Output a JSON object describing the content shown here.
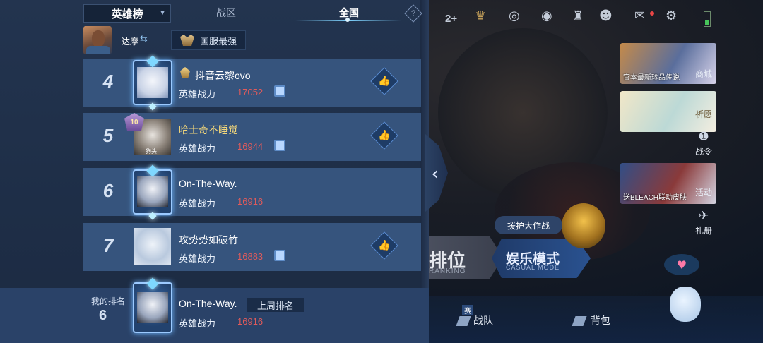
{
  "tabs": {
    "scope_selector": "英雄榜",
    "zone": "战区",
    "all": "全国"
  },
  "hero": {
    "name": "达摩",
    "server_rank": "国服最强"
  },
  "rows": [
    {
      "rank": "4",
      "name": "抖音云黎ovo",
      "power_label": "英雄战力",
      "power": "17052"
    },
    {
      "rank": "5",
      "name": "哈士奇不睡觉",
      "badge_level": "10",
      "power_label": "英雄战力",
      "power": "16944",
      "avatar_caption": "狗头"
    },
    {
      "rank": "6",
      "name": "On-The-Way.",
      "power_label": "英雄战力",
      "power": "16916"
    },
    {
      "rank": "7",
      "name": "攻势势如破竹",
      "power_label": "英雄战力",
      "power": "16883"
    }
  ],
  "my_rank": {
    "label": "我的排名",
    "number": "6",
    "name": "On-The-Way.",
    "last_week_label": "上周排名",
    "power_label": "英雄战力",
    "power": "16916"
  },
  "top_bar": {
    "count": "2+"
  },
  "side": {
    "shop_caption": "官本最新珍品传说",
    "shop_label": "商城",
    "wish_label": "祈愿",
    "pass_label": "战令",
    "activity_caption": "送BLEACH联动皮肤",
    "activity_label": "活动",
    "gift_label": "礼册"
  },
  "modes": {
    "ranked": "排位",
    "ranked_en": "RANKING",
    "casual": "娱乐模式",
    "casual_en": "CASUAL MODE",
    "event_tag": "援护大作战"
  },
  "bottom": {
    "team_tag": "赛",
    "team": "战队",
    "bag": "背包"
  },
  "colors": {
    "panel_bg": "#23344f",
    "row_bg": "#36547d",
    "power_red": "#e05b5b",
    "gold_name": "#f2d67a"
  }
}
